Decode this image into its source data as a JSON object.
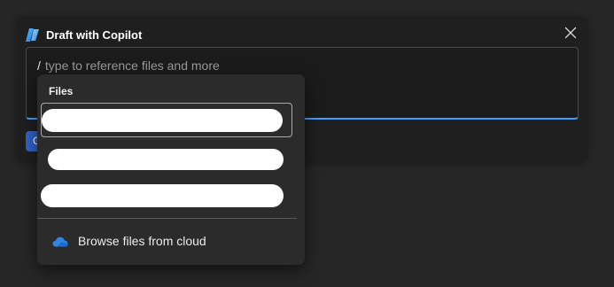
{
  "dialog": {
    "title": "Draft with Copilot",
    "close_icon": "close-icon",
    "logo_icon": "copilot-logo-icon"
  },
  "prompt": {
    "slash": "/",
    "placeholder": "type to reference files and more"
  },
  "generate_button": {
    "label": "G"
  },
  "files_menu": {
    "section_label": "Files",
    "items": [
      {
        "name": "",
        "redacted": true,
        "selected": true
      },
      {
        "name": "",
        "redacted": true,
        "selected": false
      },
      {
        "name": "",
        "redacted": true,
        "selected": false
      }
    ],
    "browse_label": "Browse files from cloud",
    "browse_icon": "onedrive-cloud-icon"
  },
  "colors": {
    "accent": "#479ef5",
    "button": "#2f62c9",
    "cloud": "#2f86e0"
  }
}
